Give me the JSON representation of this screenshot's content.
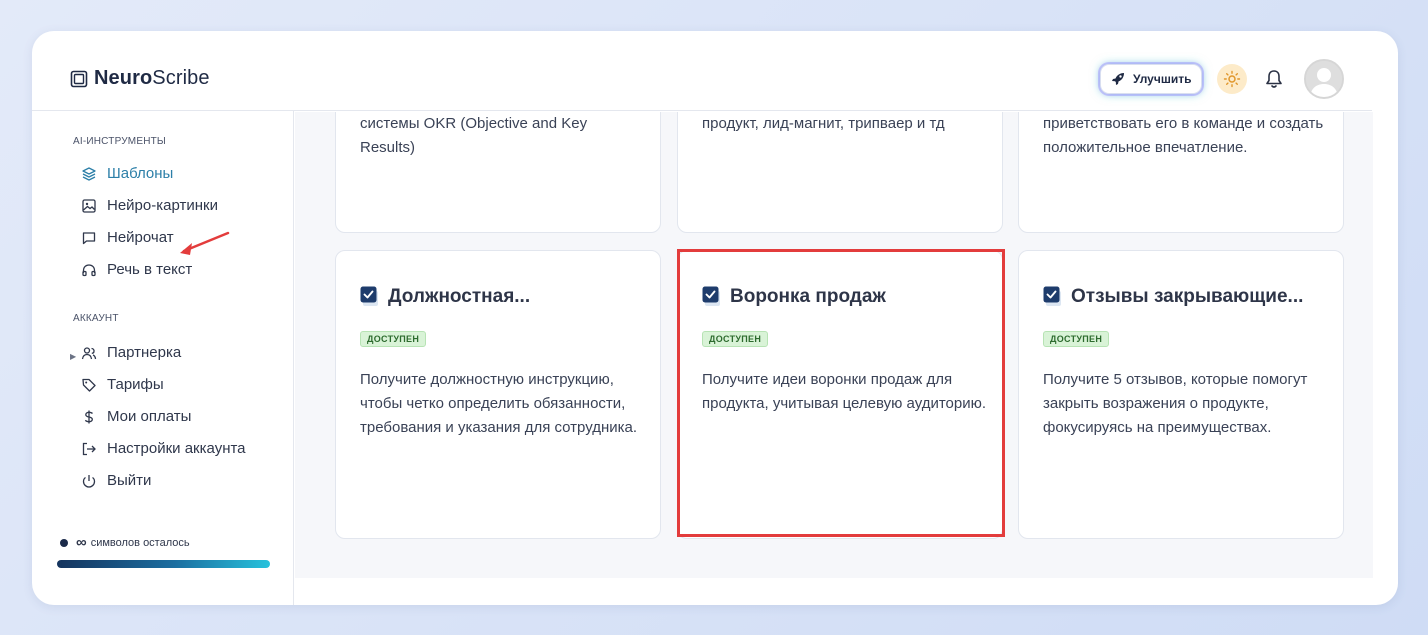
{
  "header": {
    "logo_bold": "Neuro",
    "logo_light": "Scribe",
    "upgrade_label": "Улучшить"
  },
  "sidebar": {
    "ai_section_title": "AI-ИНСТРУМЕНТЫ",
    "ai_items": [
      {
        "label": "Шаблоны",
        "icon": "layers-icon",
        "active": true
      },
      {
        "label": "Нейро-картинки",
        "icon": "image-icon"
      },
      {
        "label": "Нейрочат",
        "icon": "chat-icon"
      },
      {
        "label": "Речь в текст",
        "icon": "headphones-icon"
      }
    ],
    "account_section_title": "АККАУНТ",
    "account_items": [
      {
        "label": "Партнерка",
        "icon": "users-icon"
      },
      {
        "label": "Тарифы",
        "icon": "tag-icon"
      },
      {
        "label": "Мои оплаты",
        "icon": "dollar-icon"
      },
      {
        "label": "Настройки аккаунта",
        "icon": "logout-arrow-icon"
      },
      {
        "label": "Выйти",
        "icon": "power-icon"
      }
    ],
    "chars_value": "∞",
    "chars_label": "символов осталось",
    "progress_fraction": 1.0
  },
  "cards_top": [
    {
      "desc": "системы OKR (Objective and Key Results)"
    },
    {
      "desc": "продукт, лид-магнит, трипваер и тд"
    },
    {
      "desc": "приветствовать его в команде и создать положительное впечатление."
    }
  ],
  "cards": [
    {
      "title": "Должностная...",
      "badge": "ДОСТУПЕН",
      "desc": "Получите должностную инструкцию, чтобы четко определить обязанности, требования и указания для сотрудника."
    },
    {
      "title": "Воронка продаж",
      "badge": "ДОСТУПЕН",
      "desc": "Получите идеи воронки продаж для продукта, учитывая целевую аудиторию."
    },
    {
      "title": "Отзывы закрывающие...",
      "badge": "ДОСТУПЕН",
      "desc": "Получите 5 отзывов, которые помогут закрыть возражения о продукте, фокусируясь на преимуществах."
    }
  ],
  "colors": {
    "accent": "#2c7fa8",
    "highlight": "#e33c3c",
    "badge_bg": "#d9f3d7"
  }
}
